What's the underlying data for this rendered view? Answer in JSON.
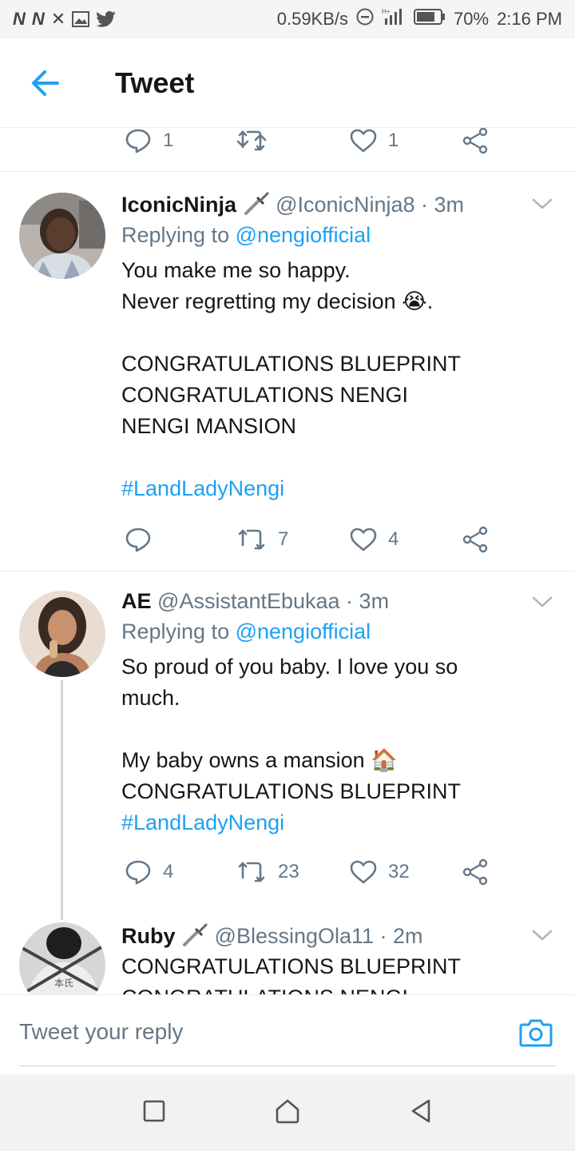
{
  "status_bar": {
    "left_icons": [
      "n-icon",
      "n-icon",
      "x-icon",
      "image-icon",
      "twitter-icon"
    ],
    "speed": "0.59KB/s",
    "battery": "70%",
    "time": "2:16 PM"
  },
  "header": {
    "title": "Tweet"
  },
  "top_actions": {
    "replies": "1",
    "retweets": "",
    "likes": "1"
  },
  "tweets": [
    {
      "name": "IconicNinja",
      "handle": "@IconicNinja8 · 3m",
      "replying_prefix": "Replying to ",
      "replying_to": "@nengiofficial",
      "text": "You make me so happy.\nNever regretting my decision 😭.\n\nCONGRATULATIONS BLUEPRINT\nCONGRATULATIONS NENGI\nNENGI MANSION",
      "hashtag": "#LandLadyNengi",
      "replies": "",
      "retweets": "7",
      "likes": "4"
    },
    {
      "name": "AE",
      "handle": "@AssistantEbukaa · 3m",
      "replying_prefix": "Replying to ",
      "replying_to": "@nengiofficial",
      "text": "So proud of you baby. I love you so\nmuch.\n\nMy baby owns a mansion 🏠\nCONGRATULATIONS BLUEPRINT",
      "hashtag": "#LandLadyNengi",
      "replies": "4",
      "retweets": "23",
      "likes": "32"
    },
    {
      "name": "Ruby",
      "handle": "@BlessingOla11 · 2m",
      "text": "CONGRATULATIONS BLUEPRINT\nCONGRATULATIONS NENGI"
    }
  ],
  "reply_bar": {
    "placeholder": "Tweet your reply"
  },
  "colors": {
    "accent": "#1da1f2",
    "secondary_text": "#657786",
    "divider": "#e6ecf0"
  }
}
